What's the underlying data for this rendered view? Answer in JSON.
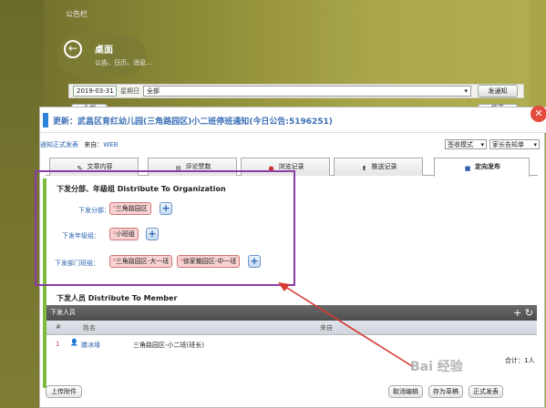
{
  "background": {
    "title": "公告栏",
    "desktop_title": "桌面",
    "desktop_sub": "公告、日历、消息...",
    "date": "2019-03-31",
    "weekday": "星期日",
    "filter_value": "全部",
    "publish_btn": "发通知",
    "all_btn": "全部",
    "search_btn": "搜索"
  },
  "dialog": {
    "title": "更新：武昌区育红幼儿园(三角路园区)小二班停班通知(今日公告:5196251)",
    "notice_type": "通知正式发表",
    "source_label": "来自：",
    "source_value": "WEB",
    "sign_mode": "签收模式",
    "parent_notice": "家长告知单",
    "tabs": [
      {
        "label": "文章内容"
      },
      {
        "label": "评论赞数"
      },
      {
        "label": "浏览记录"
      },
      {
        "label": "推送记录"
      },
      {
        "label": "定向发布"
      }
    ],
    "org_section_title": "下发分部、年级组 Distribute To Organization",
    "rows": [
      {
        "label": "下发分部：",
        "chips": [
          "三角路园区"
        ]
      },
      {
        "label": "下发年级组：",
        "chips": [
          "小班组"
        ]
      },
      {
        "label": "下发部门班组：",
        "chips": [
          "三角路园区-大一班",
          "徐家棚园区-中一班"
        ]
      }
    ],
    "member_section_title": "下发人员 Distribute To Member",
    "member_bar_label": "下发人员",
    "member_bar_icons": "+ ↻",
    "columns": [
      "#",
      "姓名",
      "来自"
    ],
    "members": [
      {
        "index": "1",
        "name": "滕冰缘",
        "from": "三角路园区-小二班(班长)"
      }
    ],
    "total": "合计：1人",
    "upload_btn": "上传附件",
    "cancel_btn": "取消编辑",
    "save_draft_btn": "存为草稿",
    "publish_btn": "正式发表"
  },
  "watermark": "Bai 经验"
}
